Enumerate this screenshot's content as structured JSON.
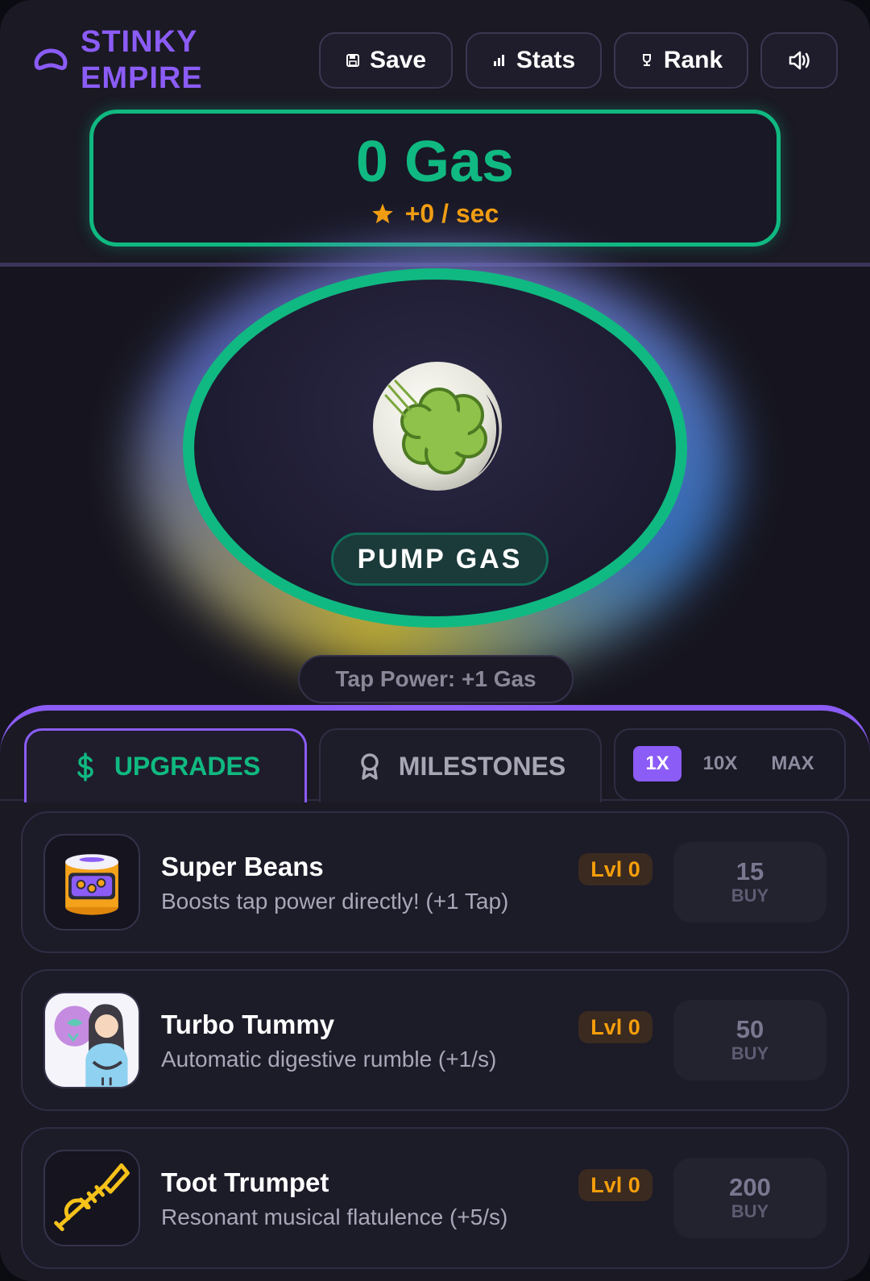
{
  "brand": {
    "line1": "STINKY",
    "line2": "EMPIRE",
    "logo_icon": "cloud-logo-icon",
    "color": "#8b5cf6"
  },
  "header": {
    "save_label": "Save",
    "stats_label": "Stats",
    "rank_label": "Rank",
    "save_icon": "floppy-disk-icon",
    "stats_icon": "bar-chart-icon",
    "rank_icon": "trophy-icon",
    "sound_icon": "speaker-icon"
  },
  "gas": {
    "amount": "0 Gas",
    "rate": "+0 / sec",
    "accent": "#10b981",
    "rate_color": "#f59e0b"
  },
  "pump": {
    "label": "PUMP GAS",
    "tap_power": "Tap Power: +1 Gas"
  },
  "tabs": {
    "upgrades": "UPGRADES",
    "milestones": "MILESTONES",
    "active": "upgrades"
  },
  "multipliers": {
    "x1": "1X",
    "x10": "10X",
    "max": "MAX",
    "selected": "1X"
  },
  "upgrades": [
    {
      "title": "Super Beans",
      "desc": "Boosts tap power directly! (+1 Tap)",
      "level": "Lvl 0",
      "cost": "15",
      "buy": "BUY",
      "icon": "bean-can-icon"
    },
    {
      "title": "Turbo Tummy",
      "desc": "Automatic digestive rumble (+1/s)",
      "level": "Lvl 0",
      "cost": "50",
      "buy": "BUY",
      "icon": "tummy-person-icon"
    },
    {
      "title": "Toot Trumpet",
      "desc": "Resonant musical flatulence (+5/s)",
      "level": "Lvl 0",
      "cost": "200",
      "buy": "BUY",
      "icon": "trumpet-icon"
    }
  ]
}
